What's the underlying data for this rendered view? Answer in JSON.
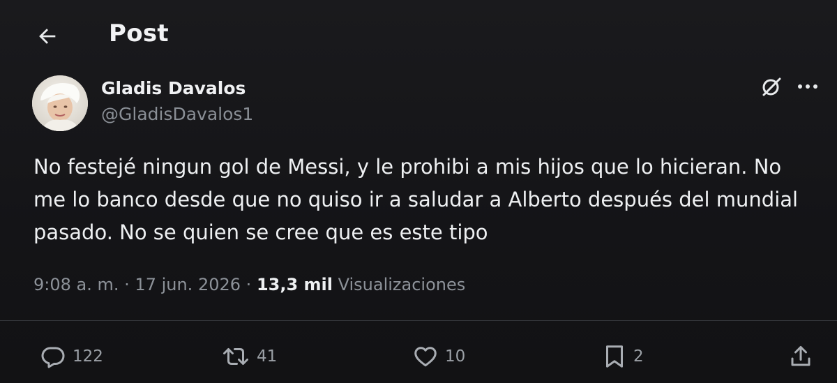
{
  "header": {
    "title": "Post",
    "back_icon": "arrow-left-icon"
  },
  "author": {
    "name": "Gladis Davalos",
    "handle": "@GladisDavalos1",
    "avatar_icon": "user-avatar"
  },
  "toolbar": {
    "grok_icon": "grok-icon",
    "more_icon": "more-horizontal-icon"
  },
  "post": {
    "text": "No festejé ningun gol de Messi, y le prohibi a mis hijos que lo hicieran. No me lo banco desde que no quiso ir a saludar a Alberto después del mundial pasado. No se quien se cree que es este tipo",
    "time": "9:08 a. m.",
    "separator": "·",
    "date": "17 jun. 2026",
    "views_count": "13,3 mil",
    "views_label": "Visualizaciones"
  },
  "actions": {
    "reply_count": "122",
    "repost_count": "41",
    "like_count": "10",
    "bookmark_count": "2"
  },
  "colors": {
    "background": "#141416",
    "text_primary": "#eef0f2",
    "text_secondary": "#8d9299",
    "divider": "#34363a"
  }
}
